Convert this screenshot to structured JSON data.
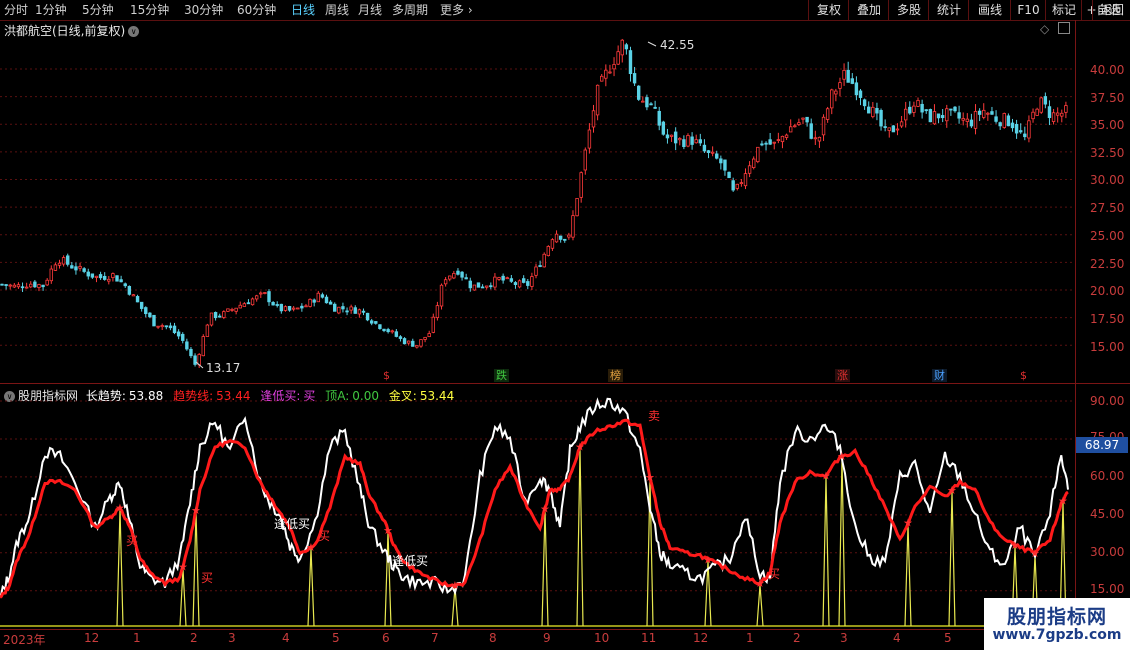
{
  "toolbar": {
    "periods": [
      "分时",
      "1分钟",
      "5分钟",
      "15分钟",
      "30分钟",
      "60分钟",
      "日线",
      "周线",
      "月线",
      "多周期",
      "更多"
    ],
    "active_period": "日线",
    "right_buttons": [
      "复权",
      "叠加",
      "多股",
      "统计",
      "画线",
      "F10",
      "标记",
      "+自选",
      "返回"
    ]
  },
  "main_chart": {
    "title": "洪都航空(日线,前复权)",
    "y_ticks": [
      "40.00",
      "37.50",
      "35.00",
      "32.50",
      "30.00",
      "27.50",
      "25.00",
      "22.50",
      "20.00",
      "17.50",
      "15.00"
    ],
    "high_label": "42.55",
    "low_label": "13.17",
    "badges": [
      {
        "text": "$",
        "color": "#e03030"
      },
      {
        "text": "跌",
        "color": "#40c840"
      },
      {
        "text": "榜",
        "color": "#e0a040"
      },
      {
        "text": "涨",
        "color": "#e03030"
      },
      {
        "text": "财",
        "color": "#4aa0ff"
      },
      {
        "text": "$",
        "color": "#e03030"
      }
    ],
    "colors": {
      "up": "#ff3b3b",
      "down": "#5ad2e6",
      "grid": "#5a1010"
    }
  },
  "indicator": {
    "name": "股朋指标网",
    "items": [
      {
        "label": "长趋势:",
        "value": "53.88",
        "color": "#ffffff"
      },
      {
        "label": "趋势线:",
        "value": "53.44",
        "color": "#ff2020"
      },
      {
        "label": "逢低买:",
        "value": "买",
        "color": "#e040e0"
      },
      {
        "label": "顶A:",
        "value": "0.00",
        "color": "#40c840"
      },
      {
        "label": "金叉:",
        "value": "53.44",
        "color": "#ffff40"
      }
    ],
    "y_ticks": [
      "90.00",
      "75.00",
      "60.00",
      "45.00",
      "30.00",
      "15.00"
    ],
    "current_value": "68.97",
    "annotations": [
      "逢低买",
      "逢低买"
    ],
    "buy_label": "买",
    "cross_label": "卖"
  },
  "x_axis": {
    "labels": [
      "2023年",
      "12",
      "1",
      "2",
      "3",
      "4",
      "5",
      "6",
      "7",
      "8",
      "9",
      "10",
      "11",
      "12",
      "1",
      "2",
      "3",
      "4",
      "5"
    ]
  },
  "watermark": {
    "line1": "股朋指标网",
    "line2": "www.7gpzb.com"
  },
  "chart_data": [
    {
      "type": "candlestick",
      "title": "洪都航空(日线,前复权)",
      "ylim": [
        13.17,
        42.55
      ],
      "series": [
        {
          "name": "close",
          "values": [
            20.5,
            20.3,
            20.6,
            20.4,
            22.9,
            22.2,
            21.6,
            21.1,
            21.4,
            20.3,
            18.5,
            17.0,
            16.7,
            15.6,
            13.2,
            17.6,
            17.8,
            18.5,
            19.1,
            19.6,
            18.3,
            18.1,
            18.6,
            19.6,
            18.4,
            18.3,
            18.1,
            17.0,
            16.3,
            15.4,
            15.0,
            16.2,
            21.1,
            21.8,
            20.3,
            20.5,
            21.0,
            20.6,
            20.4,
            22.6,
            25.3,
            24.5,
            31.0,
            37.6,
            40.3,
            42.5,
            37.6,
            36.6,
            33.8,
            33.5,
            33.6,
            32.3,
            31.6,
            28.5,
            31.3,
            33.4,
            33.1,
            34.7,
            35.4,
            33.2,
            37.5,
            39.5,
            38.1,
            36.1,
            34.0,
            35.2,
            37.1,
            35.6,
            35.9,
            35.7,
            35.1,
            36.3,
            35.5,
            35.3,
            33.6,
            37.2,
            35.8,
            36.1
          ]
        }
      ]
    },
    {
      "type": "line",
      "title": "股朋指标网",
      "ylim": [
        10,
        95
      ],
      "x": [
        0,
        8,
        18,
        30,
        45,
        60,
        75,
        95,
        110,
        120,
        130,
        140,
        150,
        165,
        180,
        190,
        200,
        215,
        230,
        245,
        260,
        270,
        280,
        290,
        300,
        315,
        330,
        345,
        360,
        370,
        385,
        395,
        405,
        420,
        435,
        450,
        465,
        480,
        495,
        510,
        525,
        540,
        550,
        560,
        570,
        580,
        595,
        610,
        625,
        640,
        650,
        660,
        670,
        685,
        700,
        715,
        730,
        745,
        760,
        770,
        780,
        795,
        810,
        825,
        840,
        855,
        870,
        885,
        900,
        915,
        930,
        945,
        960,
        975,
        990,
        1005,
        1020,
        1035,
        1050,
        1060,
        1068
      ],
      "series": [
        {
          "name": "长趋势",
          "values": [
            12,
            20,
            35,
            45,
            70,
            68,
            58,
            40,
            52,
            58,
            42,
            25,
            20,
            18,
            28,
            50,
            72,
            82,
            70,
            85,
            58,
            50,
            45,
            33,
            28,
            42,
            72,
            78,
            55,
            40,
            30,
            24,
            20,
            18,
            18,
            15,
            20,
            60,
            80,
            75,
            50,
            60,
            55,
            40,
            70,
            80,
            88,
            90,
            85,
            70,
            48,
            30,
            25,
            22,
            20,
            24,
            28,
            45,
            22,
            20,
            58,
            78,
            75,
            80,
            72,
            40,
            28,
            26,
            60,
            65,
            45,
            68,
            60,
            45,
            30,
            25,
            40,
            28,
            45,
            68,
            58,
            55
          ]
        },
        {
          "name": "趋势线",
          "values": [
            12,
            16,
            28,
            38,
            58,
            58,
            55,
            40,
            44,
            48,
            40,
            28,
            22,
            18,
            20,
            35,
            55,
            72,
            74,
            72,
            58,
            52,
            46,
            40,
            30,
            33,
            48,
            68,
            65,
            52,
            42,
            32,
            26,
            22,
            19,
            17,
            18,
            35,
            55,
            64,
            50,
            40,
            55,
            55,
            60,
            72,
            78,
            80,
            82,
            80,
            60,
            42,
            32,
            30,
            29,
            26,
            23,
            20,
            18,
            22,
            42,
            58,
            62,
            60,
            68,
            70,
            60,
            48,
            35,
            48,
            56,
            52,
            58,
            55,
            42,
            35,
            32,
            30,
            35,
            48,
            55,
            54
          ]
        }
      ]
    }
  ]
}
